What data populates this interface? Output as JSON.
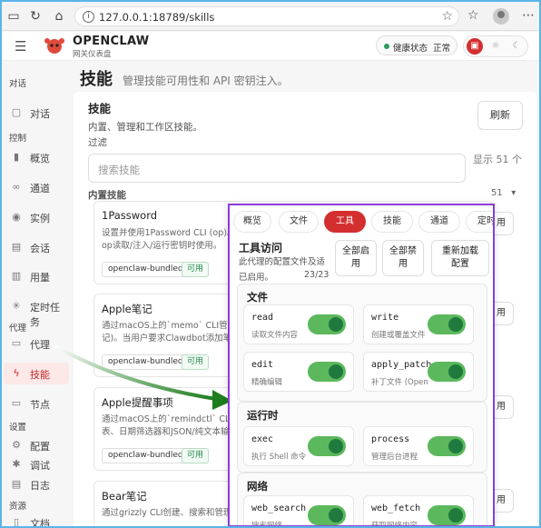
{
  "browser": {
    "url": "127.0.0.1:18789/skills"
  },
  "app": {
    "brand": "OPENCLAW",
    "brand_sub": "网关仪表盘",
    "health_label": "健康状态",
    "health_value": "正常"
  },
  "sidebar": {
    "sections": [
      {
        "label": "对话",
        "items": [
          {
            "label": "对话",
            "icon": "chat-icon"
          }
        ]
      },
      {
        "label": "控制",
        "items": [
          {
            "label": "概览",
            "icon": "bars-icon"
          },
          {
            "label": "通道",
            "icon": "link-icon"
          },
          {
            "label": "实例",
            "icon": "radio-icon"
          },
          {
            "label": "会话",
            "icon": "document-icon"
          },
          {
            "label": "用量",
            "icon": "chart-icon"
          },
          {
            "label": "定时任务",
            "icon": "spinner-icon"
          }
        ]
      },
      {
        "label": "代理",
        "items": [
          {
            "label": "代理",
            "icon": "folder-icon"
          },
          {
            "label": "技能",
            "icon": "bolt-icon",
            "active": true
          },
          {
            "label": "节点",
            "icon": "monitor-icon"
          }
        ]
      },
      {
        "label": "设置",
        "items": [
          {
            "label": "配置",
            "icon": "gear-icon"
          },
          {
            "label": "调试",
            "icon": "bug-icon"
          },
          {
            "label": "日志",
            "icon": "log-icon"
          }
        ]
      },
      {
        "label": "资源",
        "items": [
          {
            "label": "文档",
            "icon": "book-icon"
          }
        ]
      }
    ]
  },
  "page": {
    "title": "技能",
    "subtitle": "管理技能可用性和 API 密钥注入。"
  },
  "skills_card": {
    "title": "技能",
    "desc": "内置、管理和工作区技能。",
    "refresh": "刷新",
    "filter_label": "过滤",
    "search_placeholder": "搜索技能",
    "show_count": "显示 51 个",
    "builtin_label": "内置技能",
    "builtin_count": "51",
    "skills": [
      {
        "name": "1Password",
        "desc": "设置并使用1Password CLI (op)。在\nop读取/注入/运行密钥时使用。",
        "tag": "openclaw-bundled",
        "status": "可用",
        "action": "用"
      },
      {
        "name": "Apple笔记",
        "desc": "通过macOS上的`memo` CLI管理Ap\n记)。当用户要求Clawdbot添加笔",
        "tag": "openclaw-bundled",
        "status": "可用",
        "action": "用"
      },
      {
        "name": "Apple提醒事项",
        "desc": "通过macOS上的`remindctl` CLI管理\n表、日期筛选器和JSON/纯文本输",
        "tag": "openclaw-bundled",
        "status": "可用",
        "action": "用"
      },
      {
        "name": "Bear笔记",
        "desc": "通过grizzly CLI创建、搜索和管理B",
        "tag": "",
        "status": "",
        "action": "用"
      }
    ]
  },
  "tools_panel": {
    "tabs": [
      {
        "label": "概览"
      },
      {
        "label": "文件"
      },
      {
        "label": "工具",
        "active": true
      },
      {
        "label": "技能"
      },
      {
        "label": "通道"
      },
      {
        "label": "定时"
      }
    ],
    "title": "工具访问",
    "desc": "此代理的配置文件及适",
    "desc2": "已启用。",
    "count": "23/23",
    "enable_all": "全部启\n用",
    "disable_all": "全部禁\n用",
    "reload": "重新加载\n配置",
    "groups": [
      {
        "title": "文件",
        "tools": [
          {
            "name": "read",
            "desc": "读取文件内容",
            "enabled": true
          },
          {
            "name": "write",
            "desc": "创建或覆盖文件",
            "enabled": true
          },
          {
            "name": "edit",
            "desc": "精确编辑",
            "enabled": true
          },
          {
            "name": "apply_patch",
            "desc": "补丁文件 (Open",
            "enabled": true
          }
        ]
      },
      {
        "title": "运行时",
        "tools": [
          {
            "name": "exec",
            "desc": "执行 Shell 命令",
            "enabled": true
          },
          {
            "name": "process",
            "desc": "管理后台进程",
            "enabled": true
          }
        ]
      },
      {
        "title": "网络",
        "tools": [
          {
            "name": "web_search",
            "desc": "搜索网络",
            "enabled": true
          },
          {
            "name": "web_fetch",
            "desc": "获取网络内容",
            "enabled": true
          }
        ]
      }
    ]
  },
  "colors": {
    "accent": "#d32f2f",
    "highlight_border": "#8c3bd9",
    "arrow": "#1e7d1e",
    "toggle_on": "#5cb85c"
  }
}
